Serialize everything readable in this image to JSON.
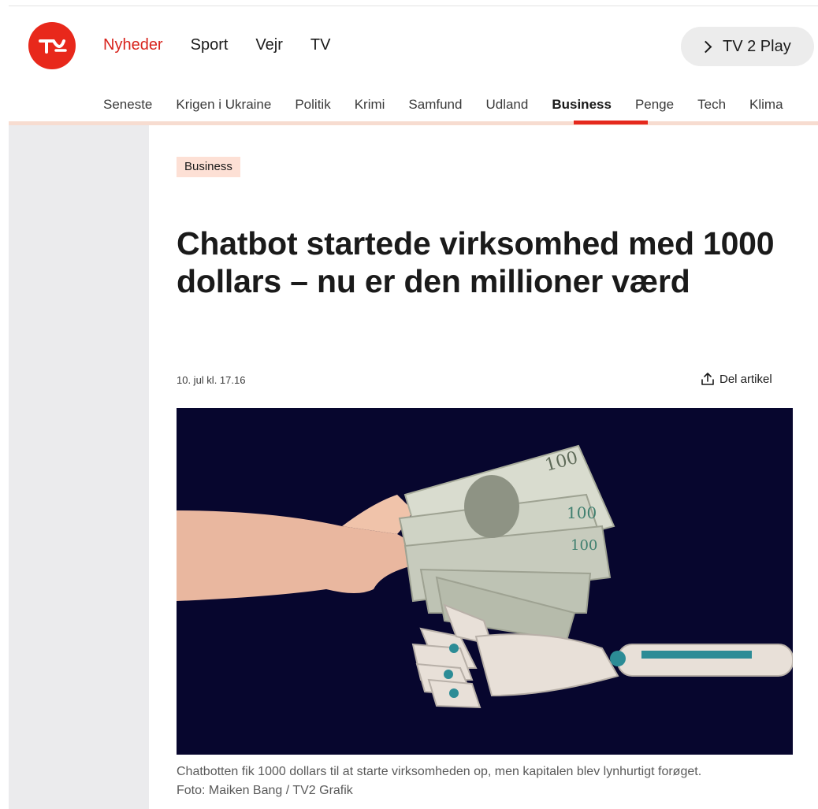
{
  "brand": {
    "logo_text": "TV2",
    "accent": "#e8281b"
  },
  "main_nav": [
    {
      "label": "Nyheder",
      "active": true
    },
    {
      "label": "Sport",
      "active": false
    },
    {
      "label": "Vejr",
      "active": false
    },
    {
      "label": "TV",
      "active": false
    }
  ],
  "play_button": {
    "label": "TV 2 Play",
    "icon": "chevron-right-icon"
  },
  "sub_nav": [
    {
      "label": "Seneste",
      "active": false
    },
    {
      "label": "Krigen i Ukraine",
      "active": false
    },
    {
      "label": "Politik",
      "active": false
    },
    {
      "label": "Krimi",
      "active": false
    },
    {
      "label": "Samfund",
      "active": false
    },
    {
      "label": "Udland",
      "active": false
    },
    {
      "label": "Business",
      "active": true
    },
    {
      "label": "Penge",
      "active": false
    },
    {
      "label": "Tech",
      "active": false
    },
    {
      "label": "Klima",
      "active": false
    }
  ],
  "article": {
    "tag": "Business",
    "headline": "Chatbot startede virksomhed med 1000 dollars – nu er den millioner værd",
    "date": "10. jul kl. 17.16",
    "share_label": "Del artikel",
    "image_caption_line1": "Chatbotten fik 1000 dollars til at starte virksomheden op, men kapitalen blev lynhurtigt forøget.",
    "image_caption_line2": "Foto: Maiken Bang / TV2 Grafik"
  }
}
